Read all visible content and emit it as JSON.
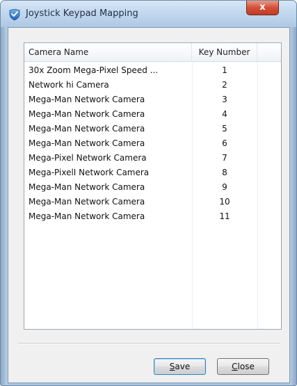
{
  "window": {
    "title": "Joystick Keypad Mapping",
    "close_glyph": "x",
    "app_icon": "app-shield-icon"
  },
  "table": {
    "columns": [
      "Camera Name",
      "Key Number",
      ""
    ],
    "rows": [
      {
        "name": "30x Zoom Mega-Pixel Speed ...",
        "key": "1"
      },
      {
        "name": "Network hi Camera",
        "key": "2"
      },
      {
        "name": "Mega-Man Network Camera",
        "key": "3"
      },
      {
        "name": "Mega-Man Network Camera",
        "key": "4"
      },
      {
        "name": "Mega-Man Network Camera",
        "key": "5"
      },
      {
        "name": "Mega-Man Network Camera",
        "key": "6"
      },
      {
        "name": "Mega-Pixel Network Camera",
        "key": "7"
      },
      {
        "name": "Mega-PixelI Network Camera",
        "key": "8"
      },
      {
        "name": "Mega-Man Network Camera",
        "key": "9"
      },
      {
        "name": "Mega-Man Network Camera",
        "key": "10"
      },
      {
        "name": "Mega-Man Network Camera",
        "key": "11"
      }
    ]
  },
  "buttons": {
    "save_label": "Save",
    "close_label": "Close"
  },
  "colors": {
    "title_text": "#1e2f45",
    "close_button": "#c33a22",
    "dialog_bg": "#f0f0f0",
    "default_button_border": "#3c7fb1"
  }
}
